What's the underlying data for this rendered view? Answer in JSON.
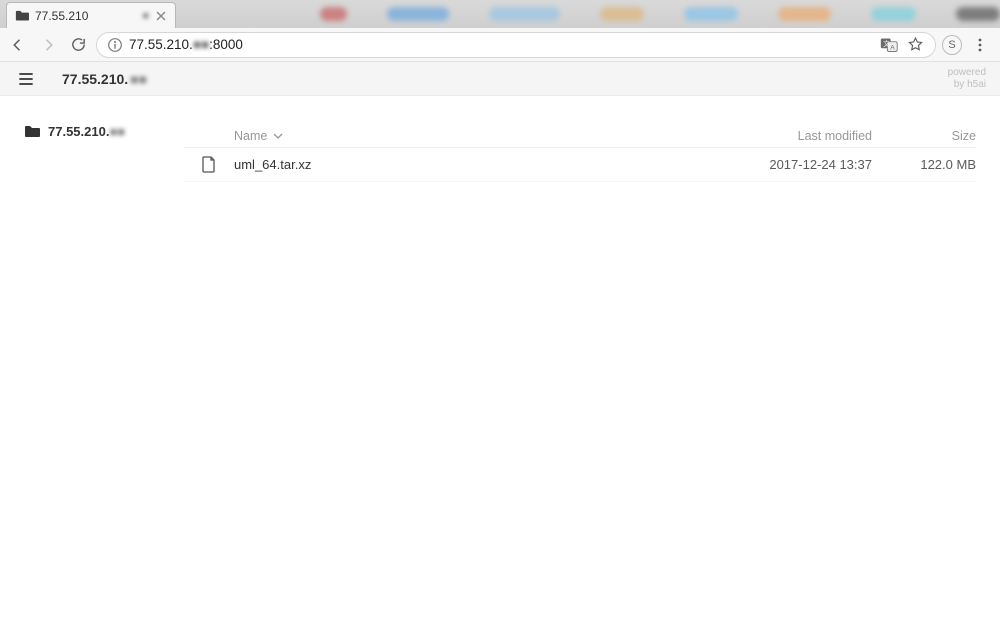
{
  "browser": {
    "tab_title": "77.55.210",
    "address_prefix": "77.55.210.",
    "address_blur": "■■",
    "address_suffix": ":8000",
    "profile_letter": "S"
  },
  "app": {
    "breadcrumb_prefix": "77.55.210.",
    "breadcrumb_blur": "■■",
    "powered_line1": "powered",
    "powered_line2": "by h5ai"
  },
  "tree": {
    "root_prefix": "77.55.210.",
    "root_blur": "■■"
  },
  "columns": {
    "name": "Name",
    "last_modified": "Last modified",
    "size": "Size"
  },
  "files": [
    {
      "name": "uml_64.tar.xz",
      "modified": "2017-12-24 13:37",
      "size": "122.0 MB"
    }
  ]
}
